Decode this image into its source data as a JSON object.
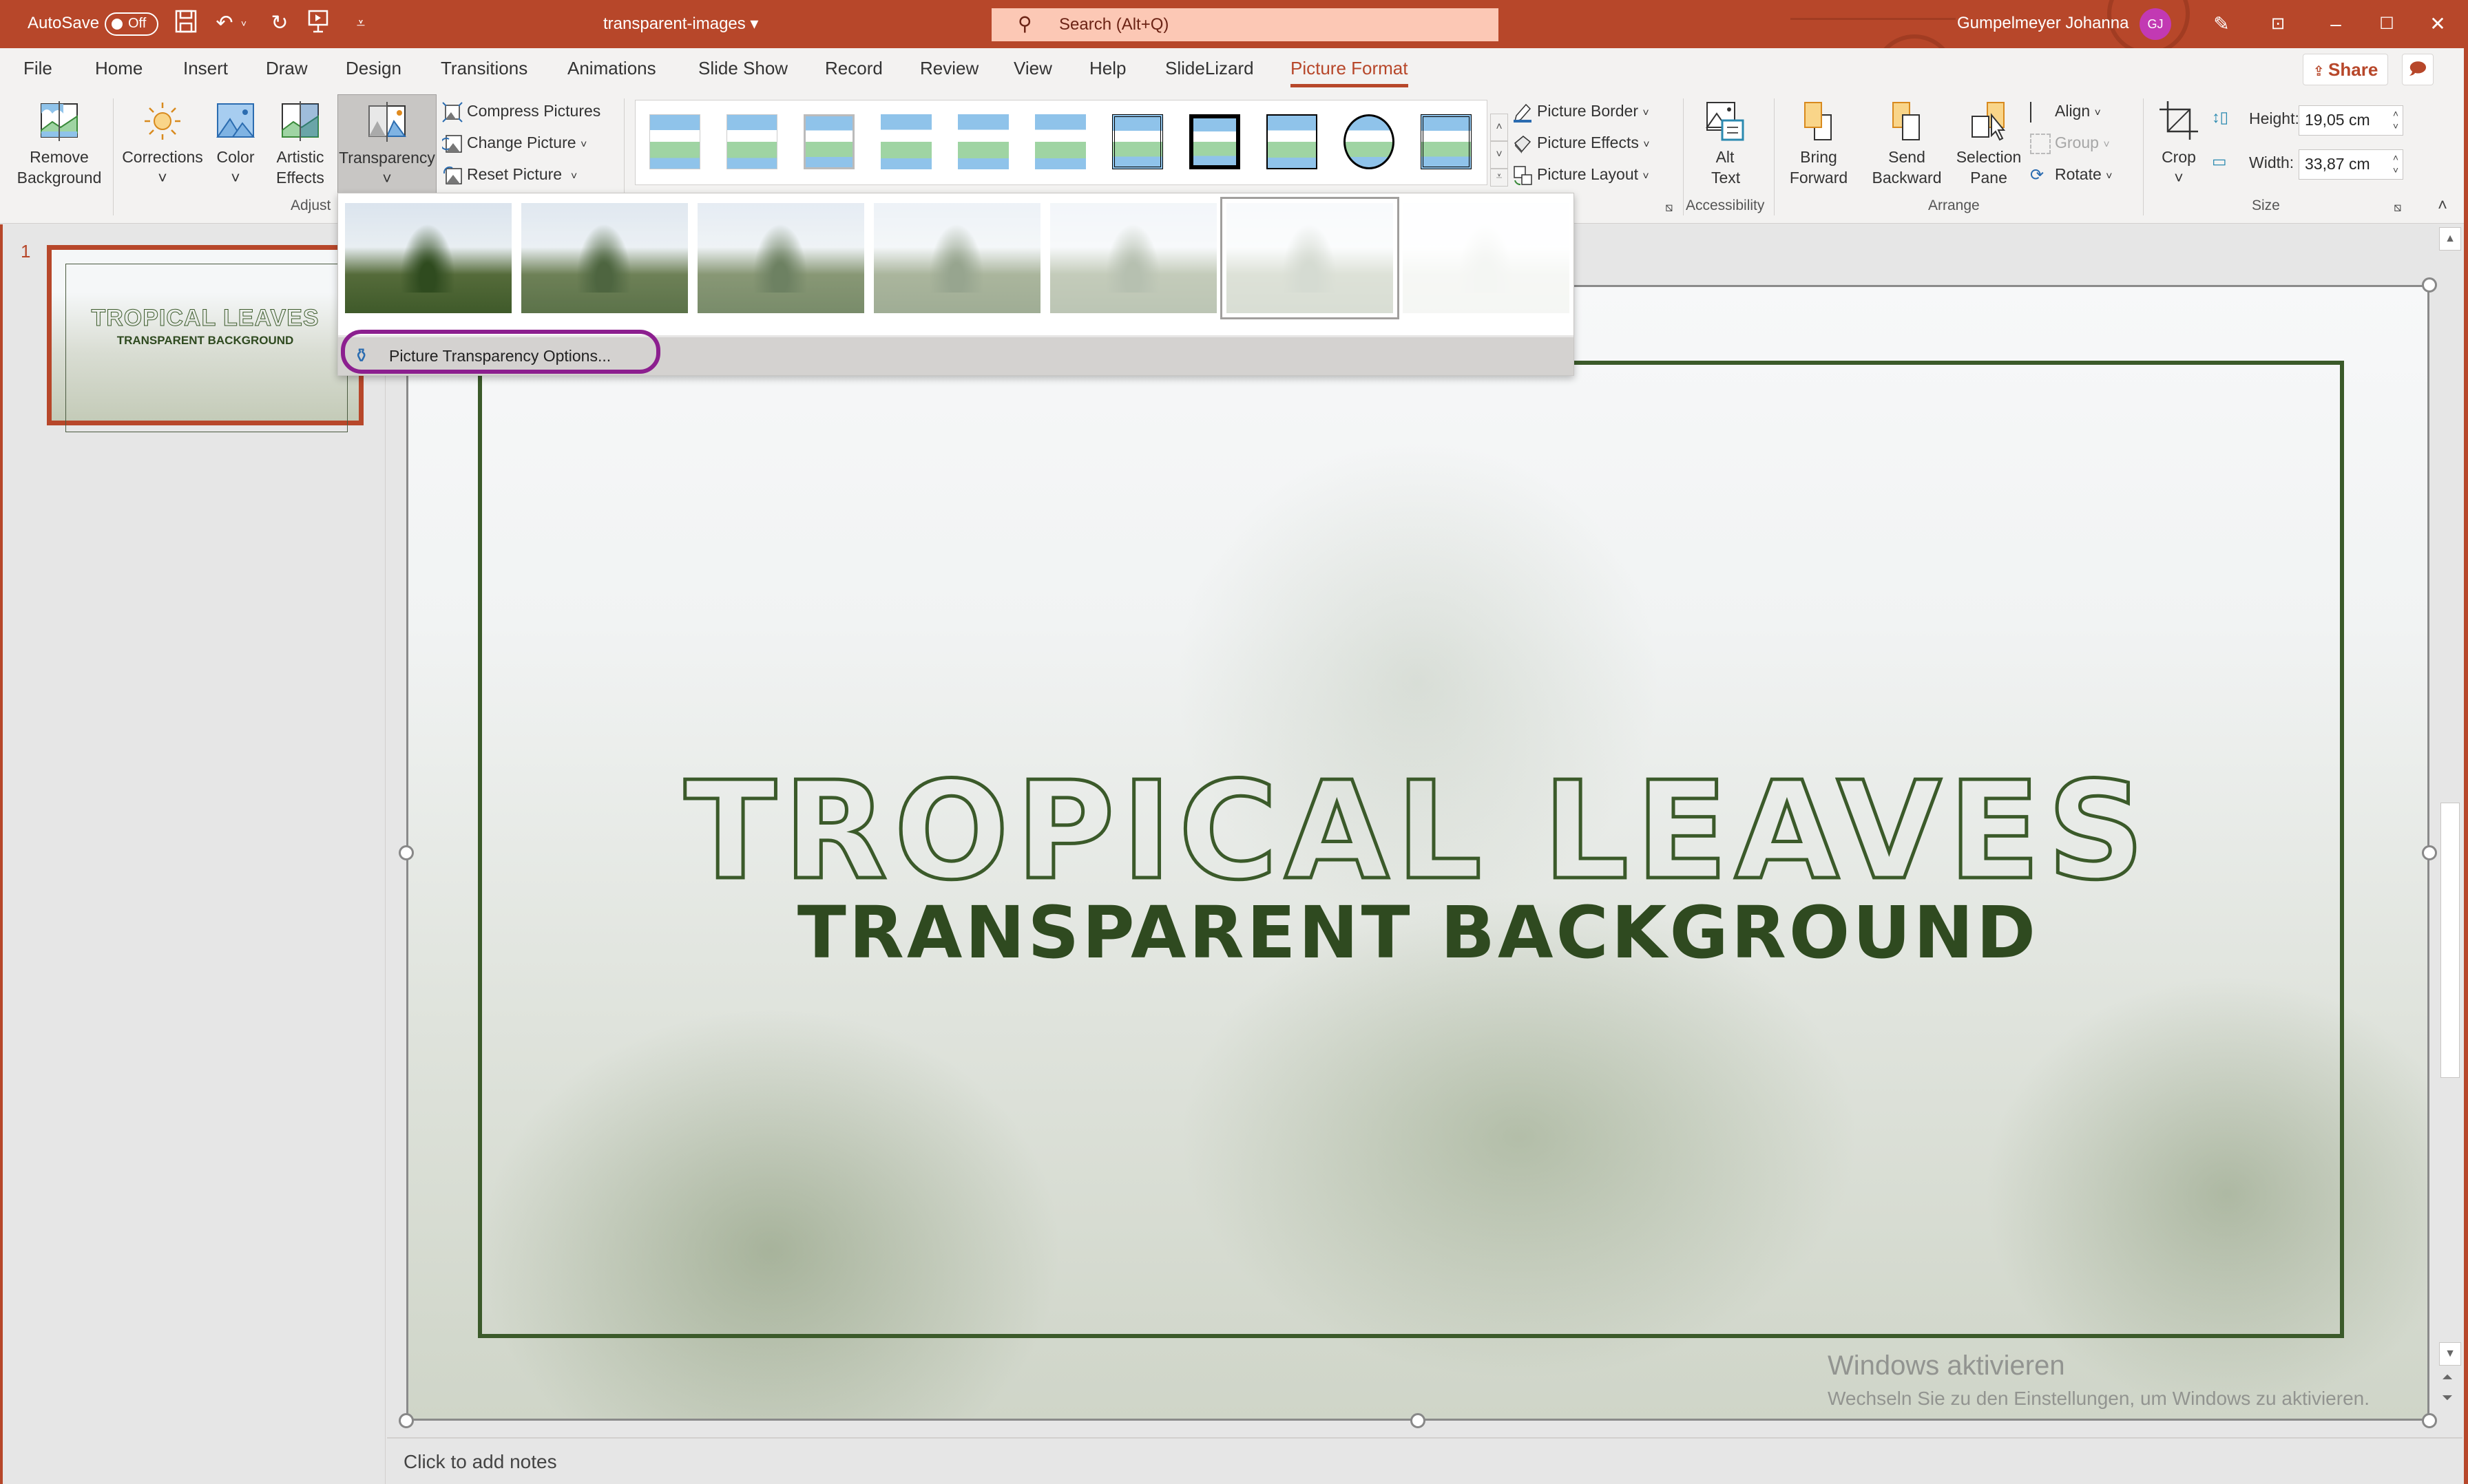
{
  "titlebar": {
    "autosave_label": "AutoSave",
    "autosave_state": "Off",
    "doc_title": "transparent-images ▾",
    "search_placeholder": "Search (Alt+Q)",
    "user_name": "Gumpelmeyer Johanna",
    "user_initials": "GJ",
    "quick_access": [
      "save-icon",
      "undo-icon",
      "redo-icon",
      "present-icon",
      "customize-icon"
    ],
    "window_controls": [
      "minimize",
      "maximize",
      "close"
    ]
  },
  "tabs": [
    {
      "label": "File"
    },
    {
      "label": "Home"
    },
    {
      "label": "Insert"
    },
    {
      "label": "Draw"
    },
    {
      "label": "Design"
    },
    {
      "label": "Transitions"
    },
    {
      "label": "Animations"
    },
    {
      "label": "Slide Show"
    },
    {
      "label": "Record"
    },
    {
      "label": "Review"
    },
    {
      "label": "View"
    },
    {
      "label": "Help"
    },
    {
      "label": "SlideLizard"
    },
    {
      "label": "Picture Format",
      "active": true
    }
  ],
  "share_label": "Share",
  "ribbon": {
    "adjust": {
      "group_label": "Adjust",
      "remove_background": "Remove Background",
      "corrections": "Corrections",
      "color": "Color",
      "artistic_effects": "Artistic Effects",
      "transparency": "Transparency",
      "compress_pictures": "Compress Pictures",
      "change_picture": "Change Picture",
      "reset_picture": "Reset Picture"
    },
    "picture_styles": {
      "style_count": 11,
      "picture_border": "Picture Border",
      "picture_effects": "Picture Effects",
      "picture_layout": "Picture Layout"
    },
    "accessibility": {
      "group_label": "Accessibility",
      "alt_text": "Alt Text"
    },
    "arrange": {
      "group_label": "Arrange",
      "bring_forward": "Bring Forward",
      "send_backward": "Send Backward",
      "selection_pane": "Selection Pane",
      "align": "Align",
      "group": "Group",
      "rotate": "Rotate"
    },
    "size": {
      "group_label": "Size",
      "crop": "Crop",
      "height_label": "Height:",
      "height_value": "19,05 cm",
      "width_label": "Width:",
      "width_value": "33,87 cm"
    }
  },
  "transparency_menu": {
    "presets": [
      {
        "transparency_percent": 0
      },
      {
        "transparency_percent": 15
      },
      {
        "transparency_percent": 30
      },
      {
        "transparency_percent": 50
      },
      {
        "transparency_percent": 65
      },
      {
        "transparency_percent": 80,
        "selected": true
      },
      {
        "transparency_percent": 95
      }
    ],
    "options_label": "Picture Transparency Options...",
    "highlight_color": "#8c1f8f"
  },
  "slides_panel": {
    "slides": [
      {
        "number": "1",
        "title": "TROPICAL LEAVES",
        "subtitle": "TRANSPARENT BACKGROUND"
      }
    ]
  },
  "slide": {
    "title": "TROPICAL LEAVES",
    "subtitle": "TRANSPARENT BACKGROUND",
    "accent_color": "#3b5a2a"
  },
  "watermark": {
    "line1": "Windows aktivieren",
    "line2": "Wechseln Sie zu den Einstellungen, um Windows zu aktivieren."
  },
  "notes_placeholder": "Click to add notes",
  "colors": {
    "brand": "#b7472a",
    "avatar": "#c239b3",
    "search_bg": "#fcc8b5"
  }
}
